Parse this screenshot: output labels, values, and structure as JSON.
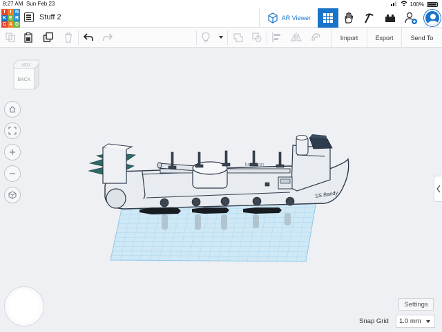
{
  "status_bar": {
    "time": "8:27 AM",
    "date": "Sun Feb 23",
    "battery": "100%"
  },
  "logo": {
    "letters": [
      "T",
      "I",
      "N",
      "K",
      "E",
      "R",
      "C",
      "A",
      "D"
    ],
    "colors": [
      "#e8432a",
      "#f37e22",
      "#2a8fd8",
      "#1a74c9",
      "#6fb642",
      "#2a8fd8",
      "#e8432a",
      "#f37e22",
      "#6fb642"
    ]
  },
  "header": {
    "title": "Stuff 2",
    "ar_label": "AR Viewer"
  },
  "toolbar": {
    "import_label": "Import",
    "export_label": "Export",
    "send_label": "Send To"
  },
  "view_cube": {
    "top_label": "TOP",
    "face_label": "BACK"
  },
  "model": {
    "hull_text": "SS Bandy",
    "deck_text": "reversed"
  },
  "settings_label": "Settings",
  "snap_grid": {
    "label": "Snap Grid",
    "value": "1.0 mm"
  },
  "colors": {
    "accent": "#1a74c9",
    "workplane": "#cfe8f6",
    "grid_line": "#8cc6e8"
  }
}
